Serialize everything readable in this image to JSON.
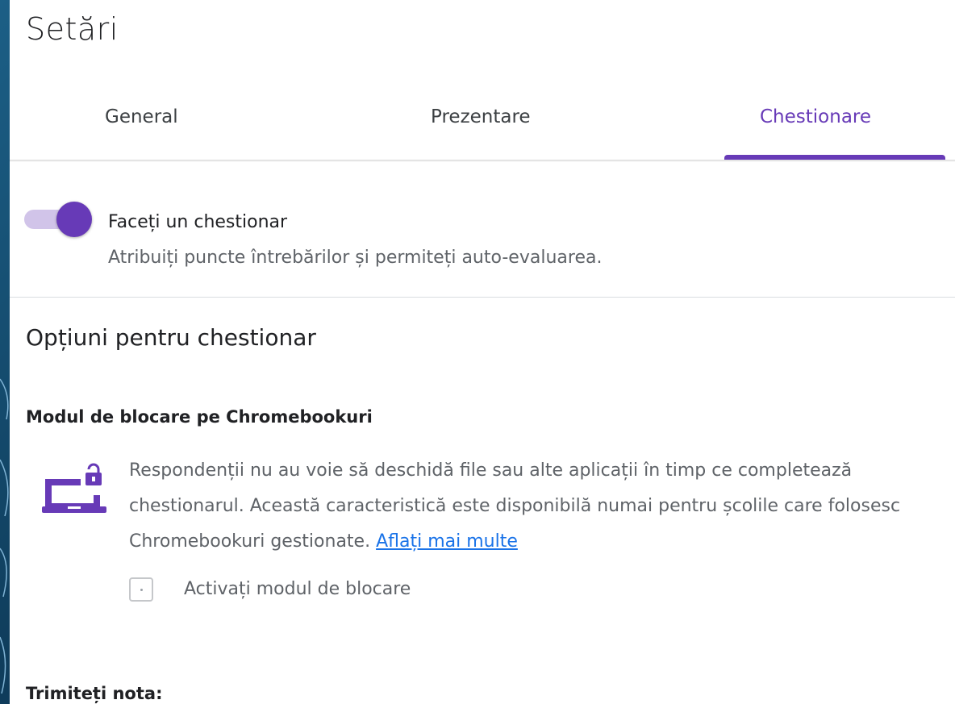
{
  "settings": {
    "title": "Setări",
    "tabs": [
      {
        "label": "General",
        "active": false
      },
      {
        "label": "Prezentare",
        "active": false
      },
      {
        "label": "Chestionare",
        "active": true
      }
    ]
  },
  "quiz_toggle": {
    "label": "Faceți un chestionar",
    "description": "Atribuiți puncte întrebărilor și permiteți auto-evaluarea.",
    "enabled": true
  },
  "quiz_options": {
    "title": "Opțiuni pentru chestionar",
    "lock_mode": {
      "title": "Modul de blocare pe Chromebookuri",
      "icon": "laptop-lock-icon",
      "description": "Respondenții nu au voie să deschidă file sau alte aplicații în timp ce completează chestionarul. Această caracteristică este disponibilă numai pentru școlile care folosesc Chromebookuri gestionate.",
      "link_label": "Aflați mai multe",
      "checkbox_label": "Activați modul de blocare",
      "checked": false
    },
    "send_grade_title": "Trimiteți nota:"
  },
  "colors": {
    "accent": "#673ab7",
    "accent_light": "#d1c4e9",
    "link": "#1a73e8"
  }
}
